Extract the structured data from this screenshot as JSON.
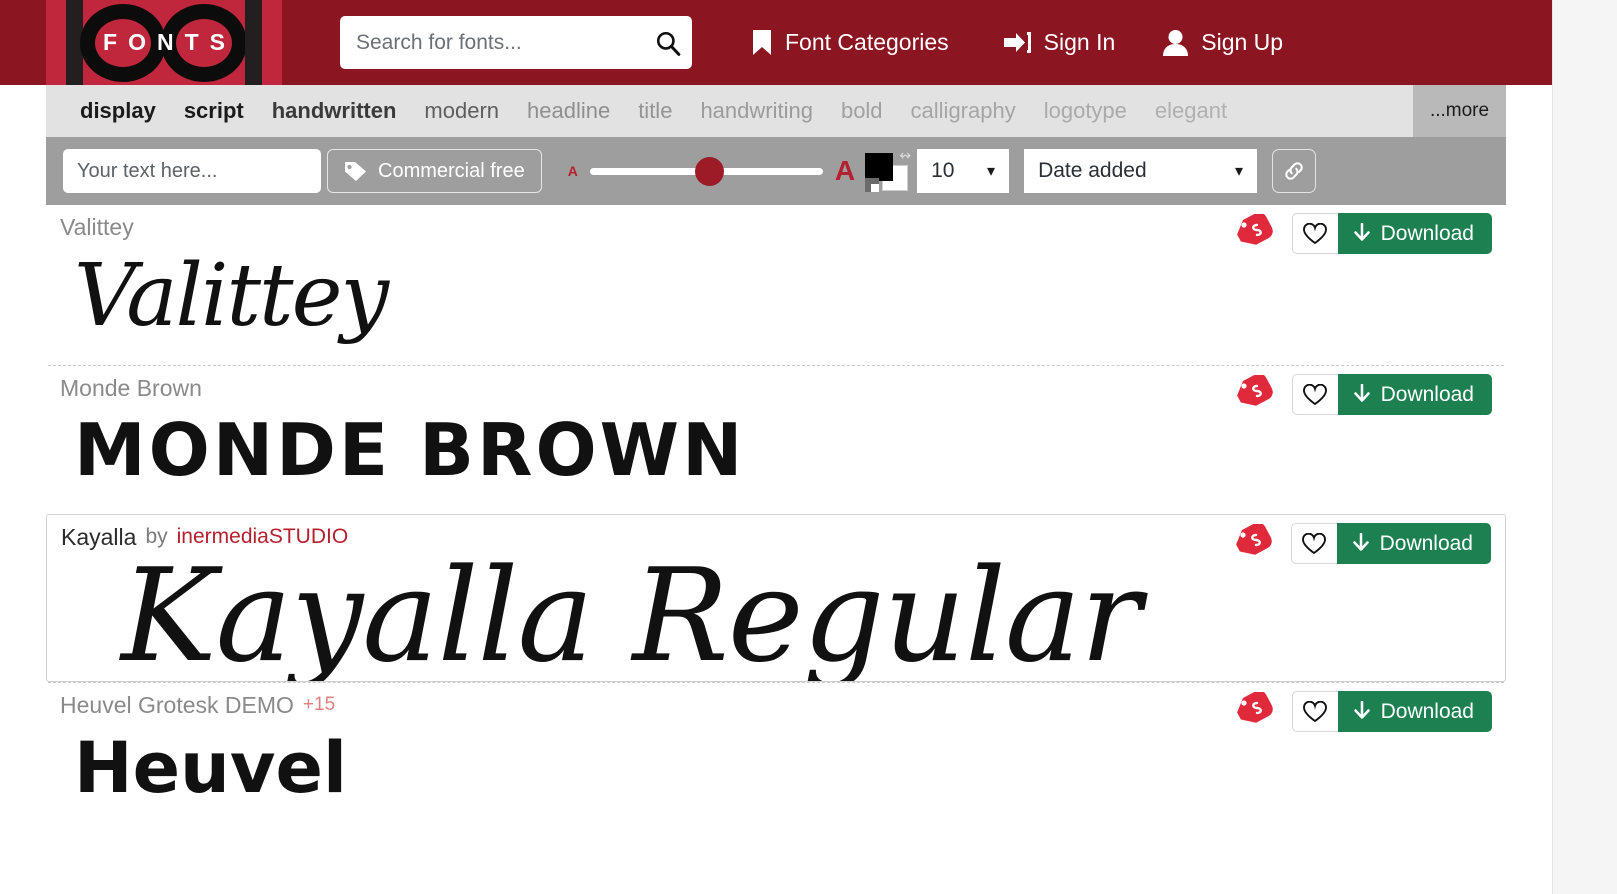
{
  "header": {
    "logo": {
      "word": "FONTS",
      "digits": "1001"
    },
    "search": {
      "placeholder": "Search for fonts...",
      "value": "",
      "icon": "search-icon"
    },
    "nav": [
      {
        "label": "Font Categories",
        "icon": "bookmark-icon"
      },
      {
        "label": "Sign In",
        "icon": "sign-in-icon"
      },
      {
        "label": "Sign Up",
        "icon": "user-icon"
      }
    ],
    "brand_color": "#8b1520",
    "logo_bg_color": "#c0263c"
  },
  "categories": {
    "items": [
      {
        "label": "display",
        "weight": "bold",
        "color": "#1b1b1b"
      },
      {
        "label": "script",
        "weight": "bold",
        "color": "#1b1b1b"
      },
      {
        "label": "handwritten",
        "weight": "bold",
        "color": "#3a3a3a"
      },
      {
        "label": "modern",
        "weight": "normal",
        "color": "#5e5e5e"
      },
      {
        "label": "headline",
        "weight": "normal",
        "color": "#8f8f8f"
      },
      {
        "label": "title",
        "weight": "normal",
        "color": "#949494"
      },
      {
        "label": "handwriting",
        "weight": "normal",
        "color": "#9b9b9b"
      },
      {
        "label": "bold",
        "weight": "normal",
        "color": "#a0a0a0"
      },
      {
        "label": "calligraphy",
        "weight": "normal",
        "color": "#a5a5a5"
      },
      {
        "label": "logotype",
        "weight": "normal",
        "color": "#aaaaaa"
      },
      {
        "label": "elegant",
        "weight": "normal",
        "color": "#b0b0b0"
      }
    ],
    "more_label": "...more"
  },
  "toolbar": {
    "text_placeholder": "Your text here...",
    "text_value": "",
    "commercial_label": "Commercial free",
    "commercial_icon": "tags-icon",
    "size_small_letter": "A",
    "size_big_letter": "A",
    "slider_percent": 45,
    "color_fg": "#000000",
    "color_bg": "#ffffff",
    "size_value": "10",
    "sort_value": "Date added",
    "link_icon": "link-icon"
  },
  "fonts": [
    {
      "name": "Valittey",
      "author": "",
      "by_label": "",
      "extra": "",
      "preview_text": "Valittey",
      "preview_style": "pv-valittey",
      "name_dark": false,
      "hovered": false,
      "has_tag": true,
      "fav_icon": "heart-icon",
      "download_label": "Download",
      "tag_icon": "price-tag-icon"
    },
    {
      "name": "Monde Brown",
      "author": "",
      "by_label": "",
      "extra": "",
      "preview_text": "MONDE BROWN",
      "preview_style": "pv-monde",
      "name_dark": false,
      "hovered": false,
      "has_tag": true,
      "fav_icon": "heart-icon",
      "download_label": "Download",
      "tag_icon": "price-tag-icon"
    },
    {
      "name": "Kayalla",
      "by_label": "by",
      "author": "inermediaSTUDIO",
      "extra": "",
      "preview_text": "Kayalla Regular",
      "preview_style": "pv-kayalla",
      "name_dark": true,
      "hovered": true,
      "has_tag": true,
      "fav_icon": "heart-icon",
      "download_label": "Download",
      "tag_icon": "price-tag-icon"
    },
    {
      "name": "Heuvel Grotesk DEMO",
      "by_label": "",
      "author": "",
      "extra": "+15",
      "preview_text": "Heuvel",
      "preview_style": "pv-heuvel",
      "name_dark": false,
      "hovered": false,
      "has_tag": true,
      "fav_icon": "heart-icon",
      "download_label": "Download",
      "tag_icon": "price-tag-icon"
    }
  ]
}
